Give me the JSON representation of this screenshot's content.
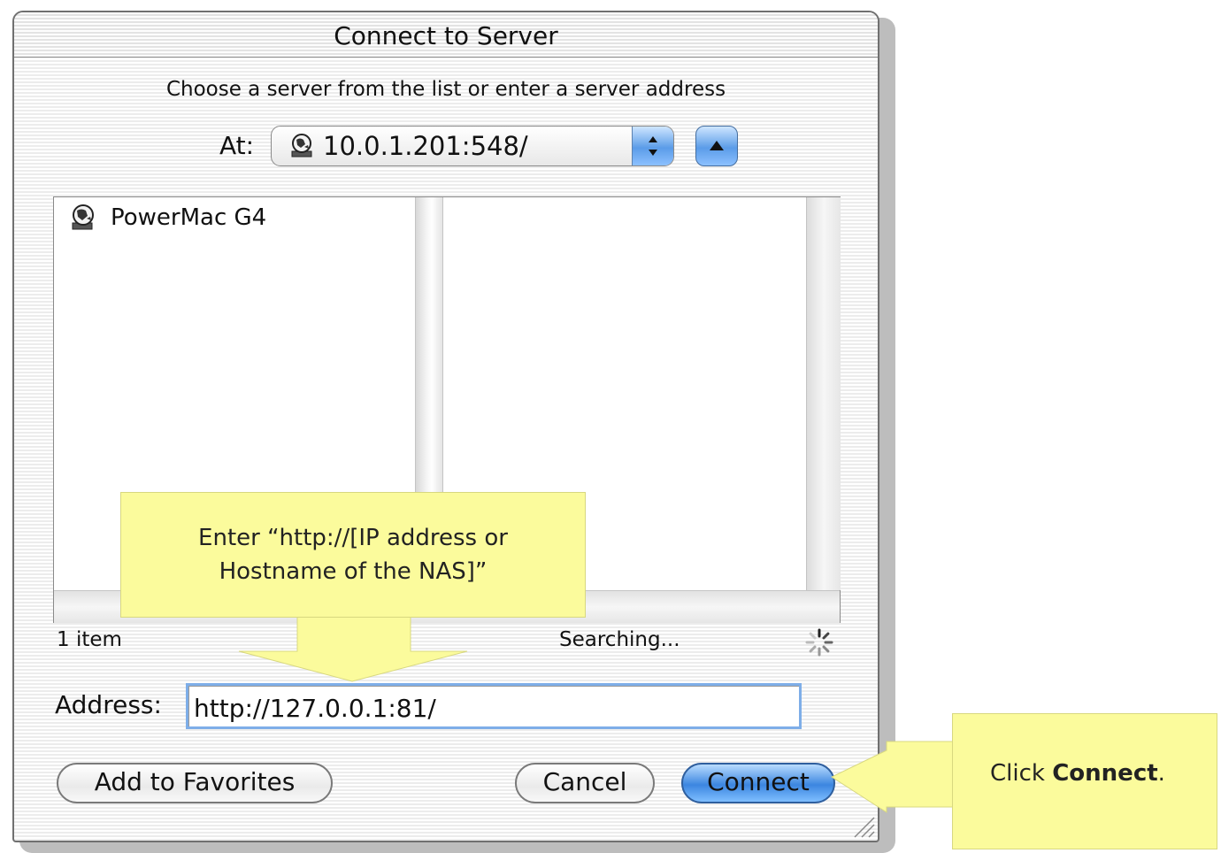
{
  "dialog": {
    "title": "Connect to Server",
    "instruction": "Choose a server from the list or enter a server address",
    "at_label": "At:",
    "at_value": "10.0.1.201:548/",
    "at_icon": "network-globe-icon"
  },
  "browser": {
    "items": [
      {
        "label": "PowerMac G4",
        "icon": "server-globe-icon"
      }
    ],
    "item_count": "1 item",
    "status": "Searching..."
  },
  "address": {
    "label": "Address:",
    "value": "http://127.0.0.1:81/"
  },
  "buttons": {
    "add_favorites": "Add to Favorites",
    "cancel": "Cancel",
    "connect": "Connect"
  },
  "callouts": {
    "enter_address_line1": "Enter “http://[IP address or",
    "enter_address_line2": "Hostname of the NAS]”",
    "click_prefix": "Click ",
    "click_bold": "Connect",
    "click_suffix": "."
  },
  "colors": {
    "callout": "#fbfb9c",
    "aqua_blue": "#3c86e0",
    "focus_ring": "#7eaee8"
  }
}
